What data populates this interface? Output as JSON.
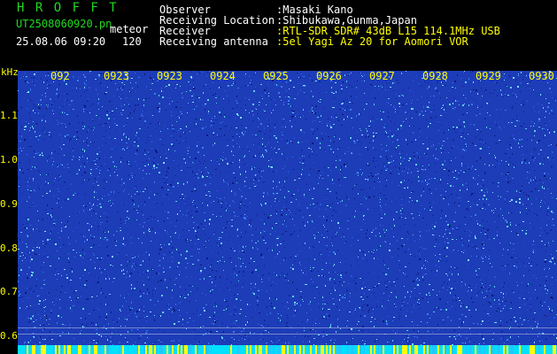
{
  "header": {
    "app_title": "H R O F F T",
    "filename": "UT2508060920.pn",
    "meteor_label": "meteor",
    "timestamp": "25.08.06 09:20",
    "count": "120"
  },
  "info": [
    {
      "label": "Observer",
      "value": ":Masaki Kano"
    },
    {
      "label": "Receiving Location",
      "value": ":Shibukawa,Gunma,Japan"
    },
    {
      "label": "Receiver",
      "value": ":RTL-SDR SDR# 43dB L15 114.1MHz USB"
    },
    {
      "label": "Receiving antenna",
      "value": ":5el Yagi Az 20 for Aomori VOR"
    }
  ],
  "axis": {
    "unit": "kHz",
    "y_ticks": [
      "1.1",
      "1.0",
      "0.9",
      "0.8",
      "0.7",
      "0.6"
    ],
    "x_ticks": [
      "092",
      "0923",
      "0923",
      "0924",
      "0925",
      "0926",
      "0927",
      "0928",
      "0929",
      "0930"
    ]
  },
  "colors": {
    "background": "#000000",
    "title": "#21d821",
    "label": "#ffffff",
    "value": "#ffff00",
    "waterfall_base": "#1d3cb8",
    "noise_bright": "#7fe0ff",
    "bottom_bar": "#00e0ff"
  }
}
